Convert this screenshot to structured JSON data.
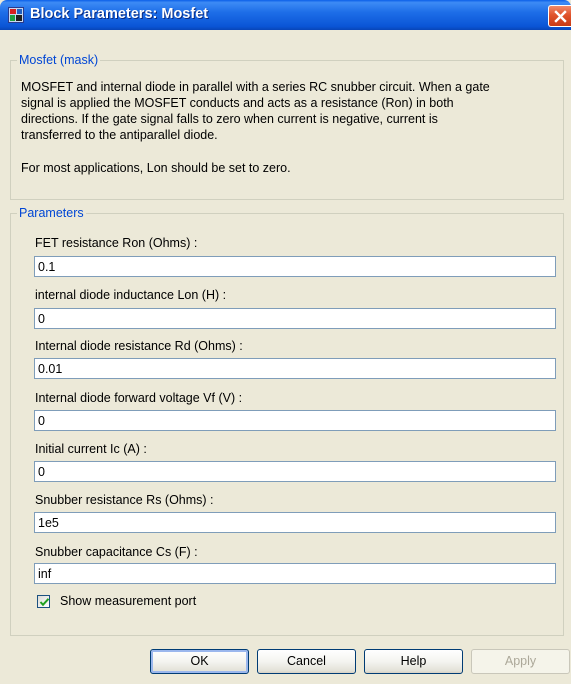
{
  "window": {
    "title": "Block Parameters: Mosfet"
  },
  "mask": {
    "legend": "Mosfet (mask)",
    "paragraph1_lines": [
      "MOSFET and internal  diode in parallel with a series RC snubber circuit. When a gate",
      "signal is applied the MOSFET conducts and acts as a resistance (Ron) in both",
      "directions. If  the gate signal falls to zero when current is negative, current  is",
      "transferred to the antiparallel diode."
    ],
    "paragraph2": "For most applications, Lon should be set to zero."
  },
  "parameters": {
    "legend": "Parameters",
    "fields": [
      {
        "label": "FET resistance Ron (Ohms) :",
        "value": "0.1"
      },
      {
        "label": "internal diode inductance Lon (H) :",
        "value": "0"
      },
      {
        "label": "Internal diode resistance Rd  (Ohms) :",
        "value": "0.01"
      },
      {
        "label": "Internal diode forward voltage Vf (V) :",
        "value": "0"
      },
      {
        "label": "Initial current Ic (A) :",
        "value": "0"
      },
      {
        "label": "Snubber resistance Rs (Ohms) :",
        "value": "1e5"
      },
      {
        "label": "Snubber capacitance Cs (F) :",
        "value": "inf"
      }
    ],
    "show_measurement_port": {
      "label": "Show measurement port",
      "checked": true
    }
  },
  "buttons": {
    "ok": "OK",
    "cancel": "Cancel",
    "help": "Help",
    "apply": "Apply"
  }
}
